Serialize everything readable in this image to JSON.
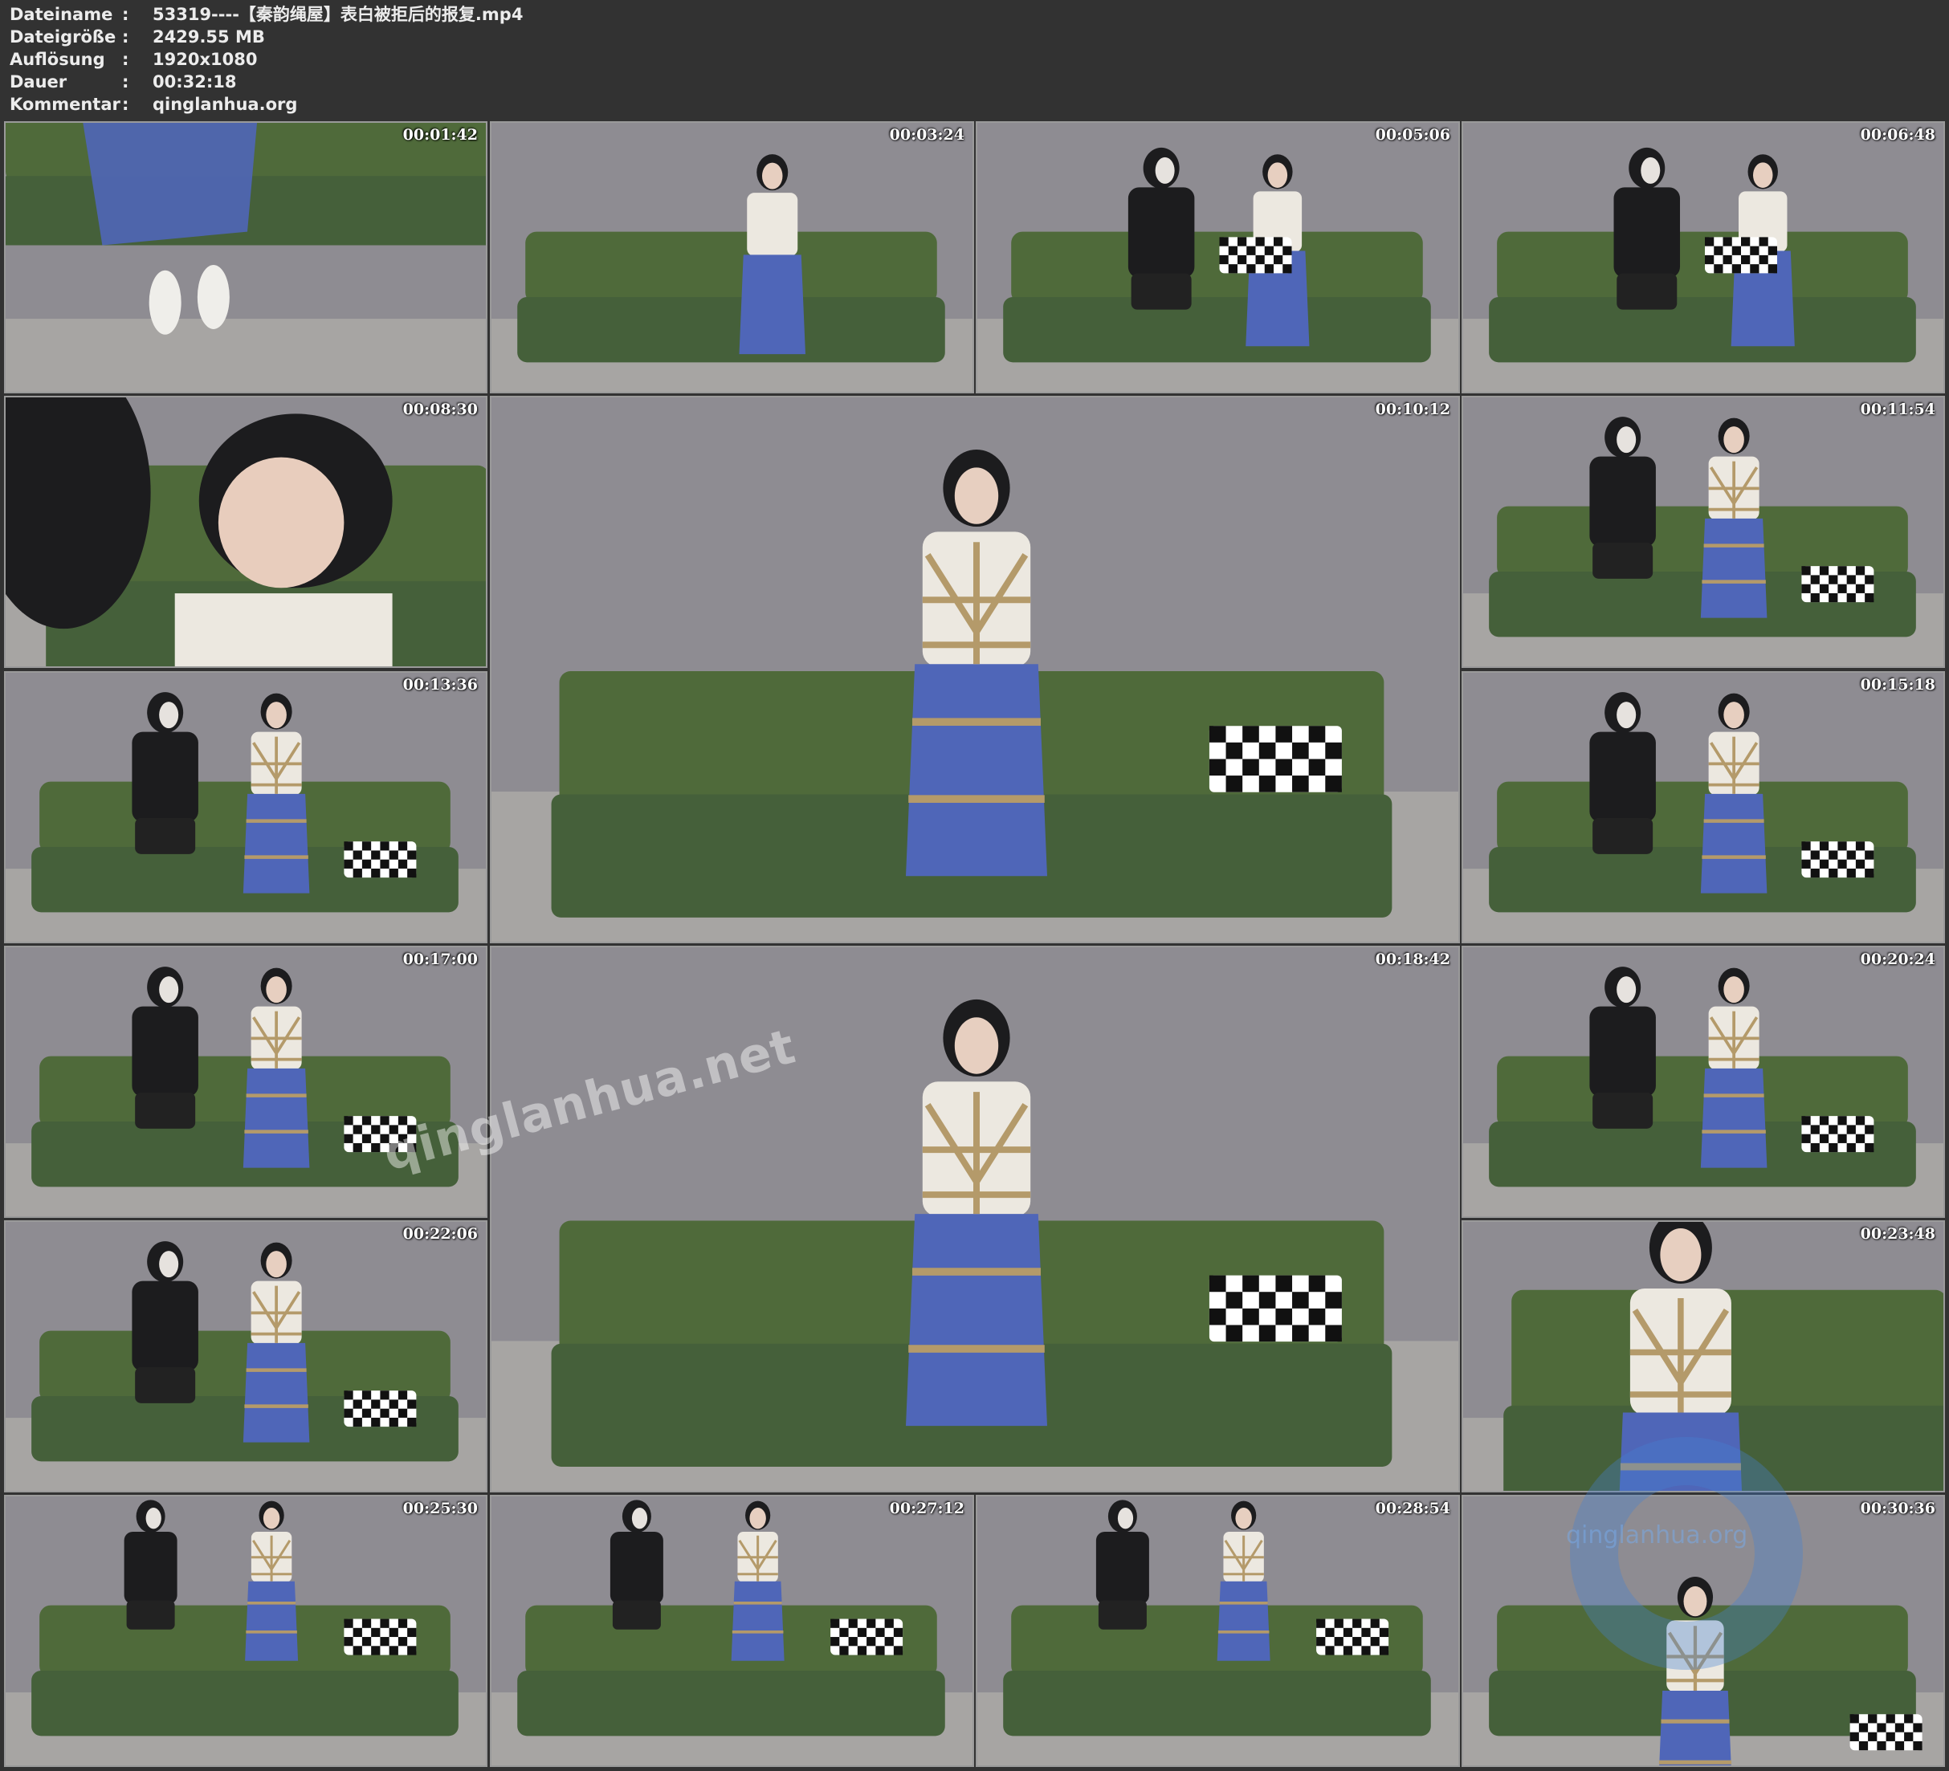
{
  "info": [
    {
      "key": "Dateiname",
      "sep": ":",
      "value": "53319----【秦韵绳屋】表白被拒后的报复.mp4"
    },
    {
      "key": "Dateigröße",
      "sep": ":",
      "value": "2429.55 MB"
    },
    {
      "key": "Auflösung",
      "sep": ":",
      "value": "1920x1080"
    },
    {
      "key": "Dauer",
      "sep": ":",
      "value": "00:32:18"
    },
    {
      "key": "Kommentar",
      "sep": ":",
      "value": "qinglanhua.org"
    }
  ],
  "thumbnails": [
    {
      "time": "00:01:42",
      "scene": "feet"
    },
    {
      "time": "00:03:24",
      "scene": "woman-sitting"
    },
    {
      "time": "00:05:06",
      "scene": "two-sitting"
    },
    {
      "time": "00:06:48",
      "scene": "two-sitting"
    },
    {
      "time": "00:08:30",
      "scene": "closeup"
    },
    {
      "time": "00:10:12",
      "scene": "woman-tied-large"
    },
    {
      "time": "00:11:54",
      "scene": "two-tied"
    },
    {
      "time": "00:13:36",
      "scene": "two-tied"
    },
    {
      "time": "00:15:18",
      "scene": "two-tied"
    },
    {
      "time": "00:17:00",
      "scene": "two-tied"
    },
    {
      "time": "00:18:42",
      "scene": "woman-tied-large"
    },
    {
      "time": "00:20:24",
      "scene": "two-tied"
    },
    {
      "time": "00:22:06",
      "scene": "two-tied"
    },
    {
      "time": "00:23:48",
      "scene": "closeup-tied"
    },
    {
      "time": "00:25:30",
      "scene": "two-tied-wide"
    },
    {
      "time": "00:27:12",
      "scene": "two-tied-wide"
    },
    {
      "time": "00:28:54",
      "scene": "two-tied-wide"
    },
    {
      "time": "00:30:36",
      "scene": "woman-tied"
    }
  ],
  "watermark": "qinglanhua.net",
  "watermark2": "qinglanhua.org",
  "colors": {
    "background": "#323232",
    "wall": "#8e8c92",
    "sofa": "#4f6a3a",
    "floor": "#a7a5a3",
    "skirt": "#4f66b8",
    "rope": "#b49a6a",
    "shirt": "#ece8e0",
    "dark": "#1c1c1e"
  }
}
